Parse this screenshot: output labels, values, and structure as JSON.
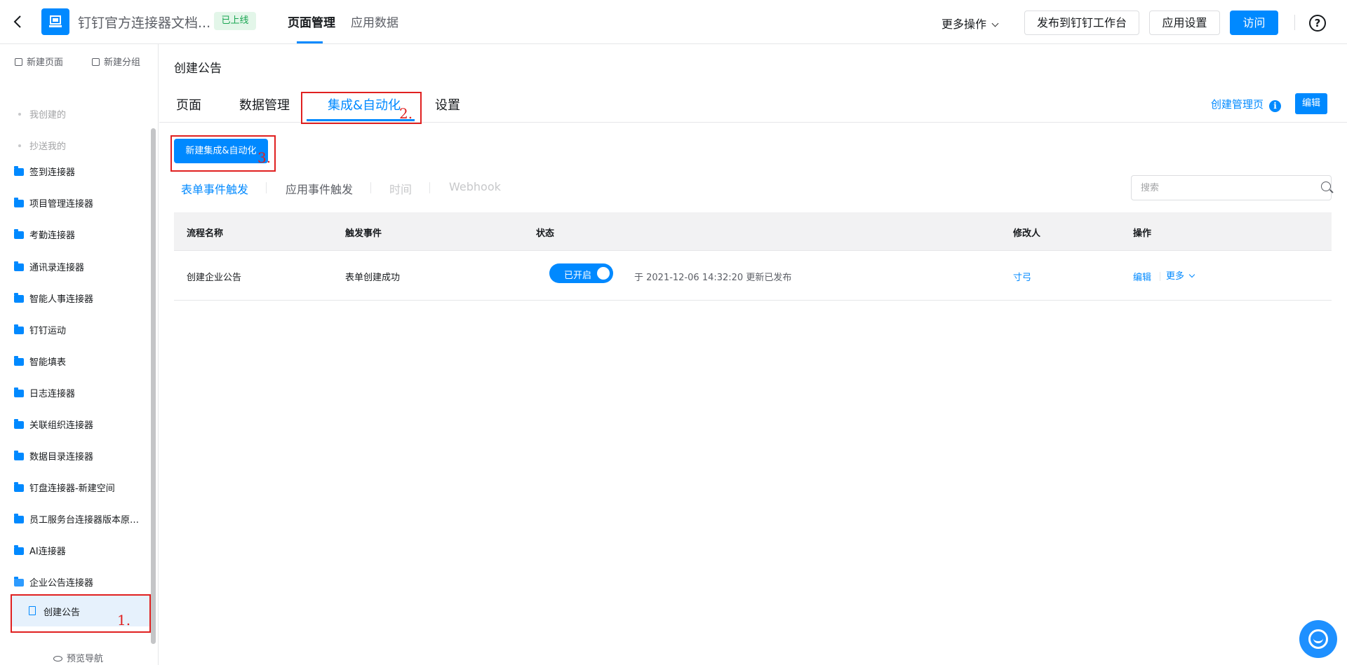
{
  "header": {
    "app_title": "钉钉官方连接器文档...",
    "status": "已上线",
    "tabs": [
      {
        "label": "页面管理",
        "active": true
      },
      {
        "label": "应用数据",
        "active": false
      }
    ],
    "more_ops": "更多操作",
    "publish_btn": "发布到钉钉工作台",
    "settings_btn": "应用设置",
    "visit_btn": "访问",
    "help_icon_glyph": "?"
  },
  "sidebar": {
    "new_page": "新建页面",
    "new_group": "新建分组",
    "sub_items": [
      "我创建的",
      "抄送我的"
    ],
    "folders": [
      "签到连接器",
      "项目管理连接器",
      "考勤连接器",
      "通讯录连接器",
      "智能人事连接器",
      "钉钉运动",
      "智能填表",
      "日志连接器",
      "关联组织连接器",
      "数据目录连接器",
      "钉盘连接器-新建空间",
      "员工服务台连接器版本原因...",
      "AI连接器",
      "企业公告连接器"
    ],
    "active_page": "创建公告",
    "preview_nav": "预览导航"
  },
  "annotations": {
    "step1": "1.",
    "step2": "2.",
    "step3": "3."
  },
  "main": {
    "page_title": "创建公告",
    "tabs": [
      {
        "label": "页面",
        "active": false
      },
      {
        "label": "数据管理",
        "active": false
      },
      {
        "label": "集成&自动化",
        "active": true
      },
      {
        "label": "设置",
        "active": false
      }
    ],
    "manage_link": "创建管理页",
    "info_glyph": "i",
    "edit_btn": "编辑",
    "new_automation_btn": "新建集成&自动化",
    "trigger_tabs": [
      {
        "label": "表单事件触发",
        "state": "active"
      },
      {
        "label": "应用事件触发",
        "state": "normal"
      },
      {
        "label": "时间",
        "state": "disabled"
      },
      {
        "label": "Webhook",
        "state": "disabled"
      }
    ],
    "search_placeholder": "搜索",
    "table": {
      "headers": [
        "流程名称",
        "触发事件",
        "状态",
        "修改人",
        "操作"
      ],
      "rows": [
        {
          "name": "创建企业公告",
          "trigger": "表单创建成功",
          "status": "已开启",
          "status_on": true,
          "update_info": "于 2021-12-06 14:32:20 更新已发布",
          "modifier": "寸弓",
          "op_edit": "编辑",
          "op_more": "更多"
        }
      ]
    }
  },
  "colors": {
    "primary": "#0089ff",
    "annotation": "#e02020",
    "online_tag_bg": "#e3f6e9",
    "online_tag_text": "#1aa552"
  }
}
